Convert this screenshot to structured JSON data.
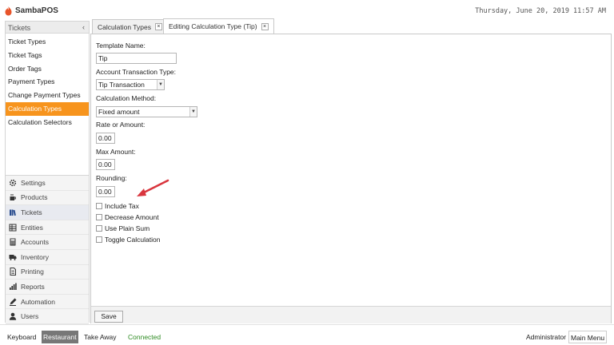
{
  "app": {
    "name": "SambaPOS",
    "clock": "Thursday, June 20, 2019 11:57 AM"
  },
  "sidebar": {
    "header": "Tickets",
    "collapse_glyph": "‹",
    "items": [
      {
        "label": "Ticket Types"
      },
      {
        "label": "Ticket Tags"
      },
      {
        "label": "Order Tags"
      },
      {
        "label": "Payment Types"
      },
      {
        "label": "Change Payment Types"
      },
      {
        "label": "Calculation Types",
        "active": true
      },
      {
        "label": "Calculation Selectors"
      }
    ],
    "menu": [
      {
        "label": "Settings",
        "icon": "gear-icon"
      },
      {
        "label": "Products",
        "icon": "coffee-icon"
      },
      {
        "label": "Tickets",
        "icon": "books-icon",
        "current": true
      },
      {
        "label": "Entities",
        "icon": "table-icon"
      },
      {
        "label": "Accounts",
        "icon": "calculator-icon"
      },
      {
        "label": "Inventory",
        "icon": "truck-icon"
      },
      {
        "label": "Printing",
        "icon": "document-icon"
      },
      {
        "label": "Reports",
        "icon": "bar-chart-icon"
      },
      {
        "label": "Automation",
        "icon": "pencil-icon"
      },
      {
        "label": "Users",
        "icon": "user-icon"
      }
    ]
  },
  "tabs": [
    {
      "label": "Calculation Types",
      "close": "×"
    },
    {
      "label": "Editing Calculation Type (Tip)",
      "close": "×",
      "active": true
    }
  ],
  "form": {
    "template_name_label": "Template Name:",
    "template_name_value": "Tip",
    "account_transaction_type_label": "Account Transaction Type:",
    "account_transaction_type_value": "Tip Transaction",
    "calculation_method_label": "Calculation Method:",
    "calculation_method_value": "Fixed amount",
    "rate_label": "Rate or Amount:",
    "rate_value": "0.00",
    "max_amount_label": "Max Amount:",
    "max_amount_value": "0.00",
    "rounding_label": "Rounding:",
    "rounding_value": "0.00",
    "checkboxes": [
      {
        "label": "Include Tax",
        "checked": false
      },
      {
        "label": "Decrease Amount",
        "checked": false
      },
      {
        "label": "Use Plain Sum",
        "checked": false
      },
      {
        "label": "Toggle Calculation",
        "checked": false
      }
    ],
    "save_label": "Save",
    "select_arrow": "▼"
  },
  "statusbar": {
    "keyboard": "Keyboard",
    "restaurant": "Restaurant",
    "take_away": "Take Away",
    "connected": "Connected",
    "user": "Administrator",
    "main_menu": "Main Menu"
  },
  "colors": {
    "accent": "#f7941d",
    "connected": "#2e8b22",
    "annotation_arrow": "#d9363e"
  }
}
